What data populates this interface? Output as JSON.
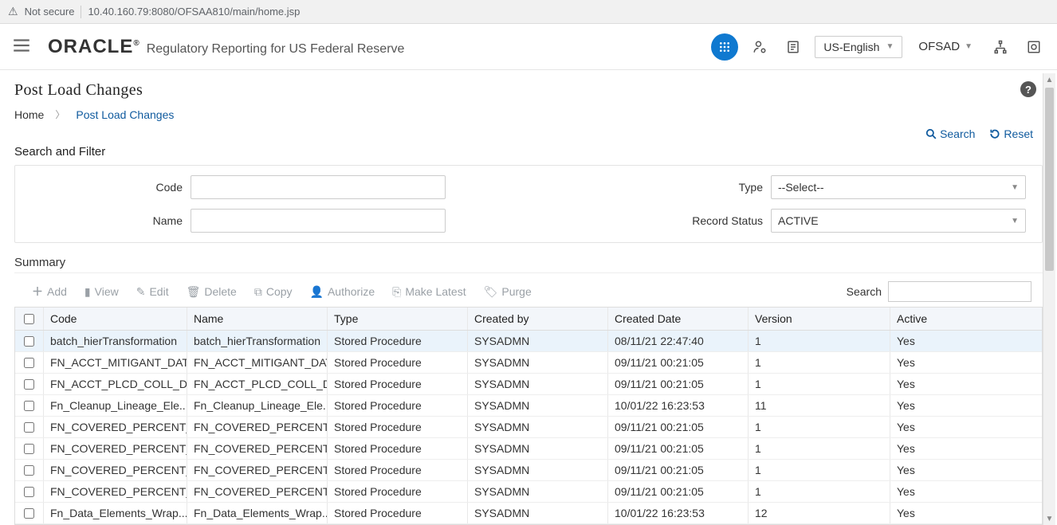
{
  "browser": {
    "security": "Not secure",
    "url": "10.40.160.79:8080/OFSAA810/main/home.jsp"
  },
  "header": {
    "brand": "ORACLE",
    "brand_suffix": "®",
    "subtitle": "Regulatory Reporting for US Federal Reserve",
    "lang": "US-English",
    "app": "OFSAD"
  },
  "page": {
    "title": "Post Load Changes"
  },
  "breadcrumb": {
    "home": "Home",
    "current": "Post Load Changes"
  },
  "search": {
    "title": "Search and Filter",
    "search_btn": "Search",
    "reset_btn": "Reset",
    "code_label": "Code",
    "name_label": "Name",
    "type_label": "Type",
    "status_label": "Record Status",
    "type_value": "--Select--",
    "status_value": "ACTIVE"
  },
  "summary": {
    "title": "Summary"
  },
  "toolbar": {
    "add": "Add",
    "view": "View",
    "edit": "Edit",
    "delete": "Delete",
    "copy": "Copy",
    "authorize": "Authorize",
    "make_latest": "Make Latest",
    "purge": "Purge",
    "search": "Search"
  },
  "table": {
    "headers": {
      "code": "Code",
      "name": "Name",
      "type": "Type",
      "created_by": "Created by",
      "created_date": "Created Date",
      "version": "Version",
      "active": "Active"
    },
    "rows": [
      {
        "code": "batch_hierTransformation",
        "name": "batch_hierTransformation",
        "type": "Stored Procedure",
        "created_by": "SYSADMN",
        "created_date": "08/11/21 22:47:40",
        "version": "1",
        "active": "Yes",
        "selected": true
      },
      {
        "code": "FN_ACCT_MITIGANT_DAT...",
        "name": "FN_ACCT_MITIGANT_DAT...",
        "type": "Stored Procedure",
        "created_by": "SYSADMN",
        "created_date": "09/11/21 00:21:05",
        "version": "1",
        "active": "Yes"
      },
      {
        "code": "FN_ACCT_PLCD_COLL_DA...",
        "name": "FN_ACCT_PLCD_COLL_DA...",
        "type": "Stored Procedure",
        "created_by": "SYSADMN",
        "created_date": "09/11/21 00:21:05",
        "version": "1",
        "active": "Yes"
      },
      {
        "code": "Fn_Cleanup_Lineage_Ele...",
        "name": "Fn_Cleanup_Lineage_Ele...",
        "type": "Stored Procedure",
        "created_by": "SYSADMN",
        "created_date": "10/01/22 16:23:53",
        "version": "11",
        "active": "Yes"
      },
      {
        "code": "FN_COVERED_PERCENT_...",
        "name": "FN_COVERED_PERCENT_...",
        "type": "Stored Procedure",
        "created_by": "SYSADMN",
        "created_date": "09/11/21 00:21:05",
        "version": "1",
        "active": "Yes"
      },
      {
        "code": "FN_COVERED_PERCENT_...",
        "name": "FN_COVERED_PERCENT_...",
        "type": "Stored Procedure",
        "created_by": "SYSADMN",
        "created_date": "09/11/21 00:21:05",
        "version": "1",
        "active": "Yes"
      },
      {
        "code": "FN_COVERED_PERCENT_...",
        "name": "FN_COVERED_PERCENT_...",
        "type": "Stored Procedure",
        "created_by": "SYSADMN",
        "created_date": "09/11/21 00:21:05",
        "version": "1",
        "active": "Yes"
      },
      {
        "code": "FN_COVERED_PERCENT_...",
        "name": "FN_COVERED_PERCENT_...",
        "type": "Stored Procedure",
        "created_by": "SYSADMN",
        "created_date": "09/11/21 00:21:05",
        "version": "1",
        "active": "Yes"
      },
      {
        "code": "Fn_Data_Elements_Wrap...",
        "name": "Fn_Data_Elements_Wrap...",
        "type": "Stored Procedure",
        "created_by": "SYSADMN",
        "created_date": "10/01/22 16:23:53",
        "version": "12",
        "active": "Yes"
      }
    ]
  }
}
